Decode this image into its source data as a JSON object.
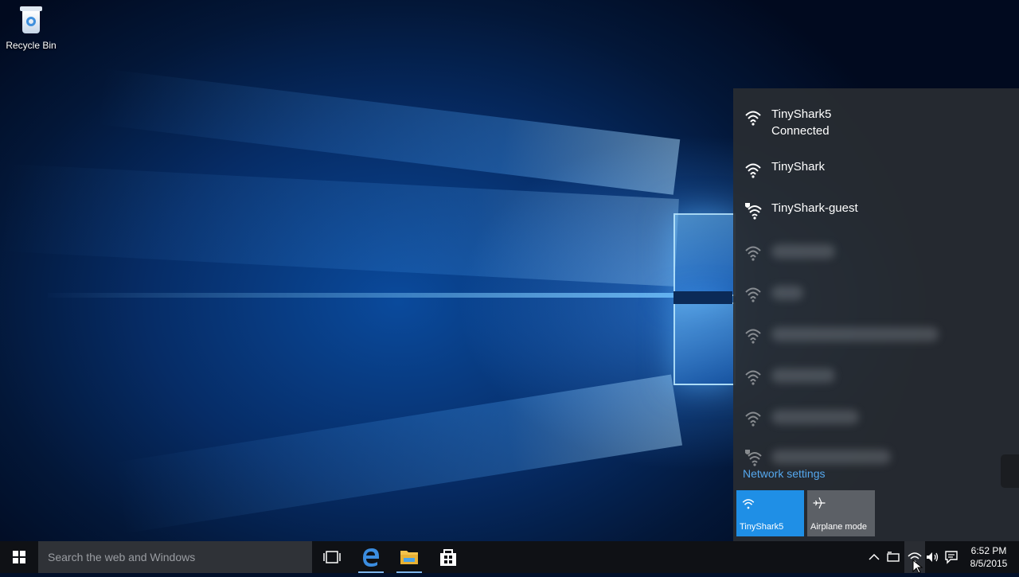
{
  "desktop": {
    "icons": [
      {
        "label": "Recycle Bin"
      }
    ]
  },
  "network_flyout": {
    "networks": [
      {
        "name": "TinyShark5",
        "status": "Connected",
        "secured": true
      },
      {
        "name": "TinyShark",
        "secured": true
      },
      {
        "name": "TinyShark-guest",
        "secured": false
      },
      {
        "name": "",
        "obscured": true
      },
      {
        "name": "",
        "obscured": true
      },
      {
        "name": "",
        "obscured": true
      },
      {
        "name": "",
        "obscured": true
      },
      {
        "name": "",
        "obscured": true
      },
      {
        "name": "",
        "obscured": true
      }
    ],
    "settings_link": "Network settings",
    "quick_actions": [
      {
        "label": "TinyShark5",
        "active": true
      },
      {
        "label": "Airplane mode",
        "active": false
      }
    ]
  },
  "taskbar": {
    "search_placeholder": "Search the web and Windows",
    "clock_time": "6:52 PM",
    "clock_date": "8/5/2015"
  },
  "colors": {
    "accent": "#1f8fe6",
    "link": "#55a8ee",
    "flyout_bg": "#282c32",
    "taskbar_bg": "#0f1115"
  }
}
